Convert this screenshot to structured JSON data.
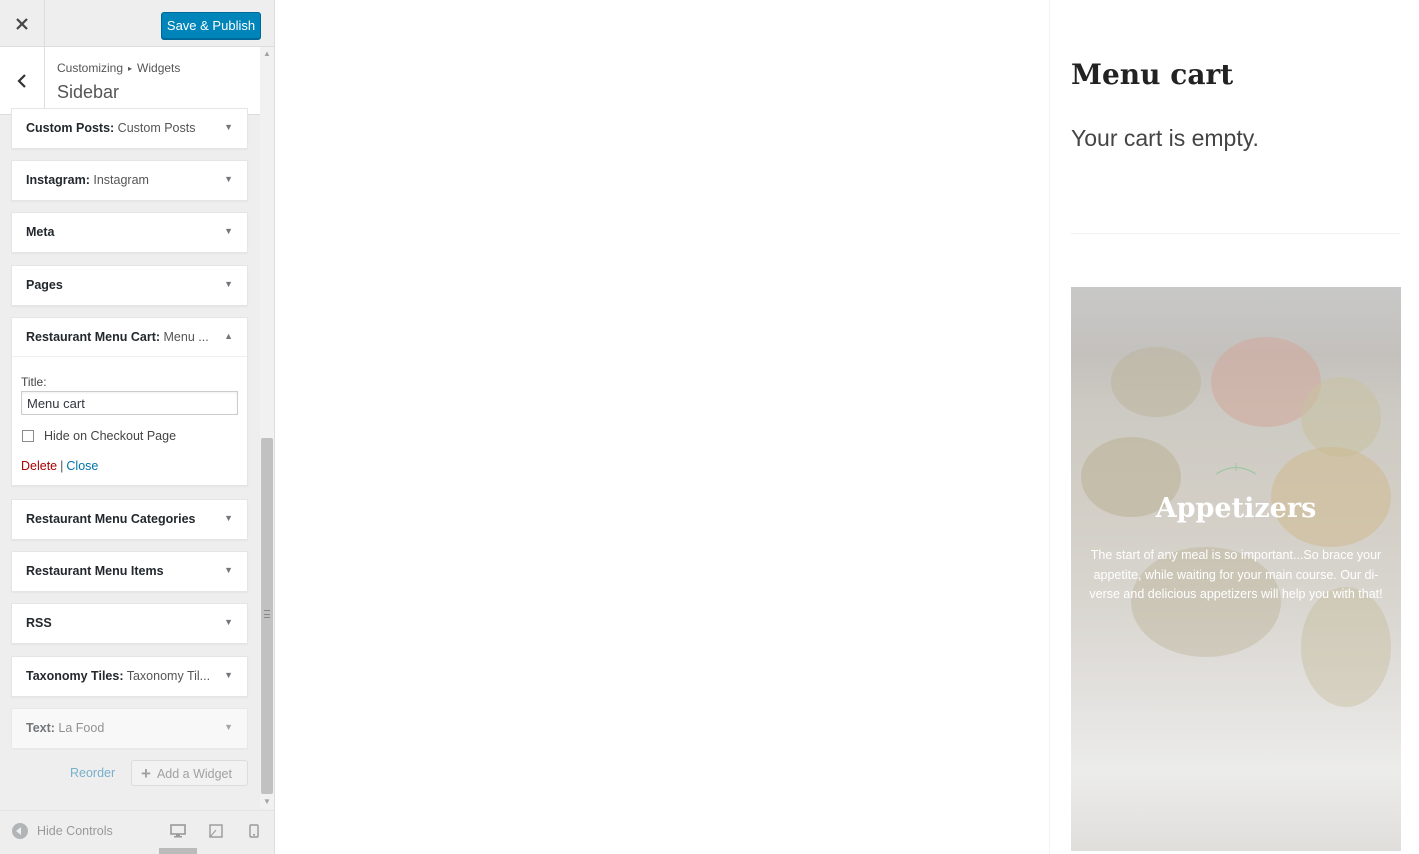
{
  "topbar": {
    "close_icon": "close-icon",
    "publish_label": "Save & Publish",
    "publish_color": "#0085ba"
  },
  "section": {
    "breadcrumb_parent": "Customizing",
    "breadcrumb_sep": "▸",
    "breadcrumb_child": "Widgets",
    "title": "Sidebar",
    "back_icon": "chevron-left-icon"
  },
  "widgets": [
    {
      "name": "Custom Posts:",
      "title": " Custom Posts",
      "arrow": "▼"
    },
    {
      "name": "Instagram:",
      "title": " Instagram",
      "arrow": "▼"
    },
    {
      "name": "Meta",
      "title": "",
      "arrow": "▼"
    },
    {
      "name": "Pages",
      "title": "",
      "arrow": "▼"
    },
    {
      "name": "Restaurant Menu Cart:",
      "title": " Menu ...",
      "arrow": "▲"
    },
    {
      "name": "Restaurant Menu Categories",
      "title": "",
      "arrow": "▼"
    },
    {
      "name": "Restaurant Menu Items",
      "title": "",
      "arrow": "▼"
    },
    {
      "name": "RSS",
      "title": "",
      "arrow": "▼"
    },
    {
      "name": "Taxonomy Tiles:",
      "title": " Taxonomy Til...",
      "arrow": "▼"
    },
    {
      "name": "Text:",
      "title": " La Food",
      "arrow": "▼"
    }
  ],
  "open_widget": {
    "title_label": "Title:",
    "title_value": "Menu cart",
    "checkbox_label": "Hide on Checkout Page",
    "checkbox_checked": false,
    "delete_label": "Delete",
    "separator": "|",
    "close_label": "Close"
  },
  "footer": {
    "reorder_label": "Reorder",
    "add_widget_label": "Add a Widget",
    "add_icon": "plus-icon"
  },
  "bottom_bar": {
    "hide_controls_label": "Hide Controls",
    "devices": [
      "desktop-icon",
      "tablet-icon",
      "mobile-icon"
    ]
  },
  "preview": {
    "cart_heading": "Menu cart",
    "cart_empty": "Your cart is empty.",
    "tile_title": "Appetizers",
    "tile_description": "The start of any meal is so important...So brace your appetite, while waiting for your main course. Our di-verse and delicious appetizers will help you with that!"
  },
  "colors": {
    "accent": "#0085ba",
    "link": "#0073aa",
    "delete": "#aa0000"
  }
}
